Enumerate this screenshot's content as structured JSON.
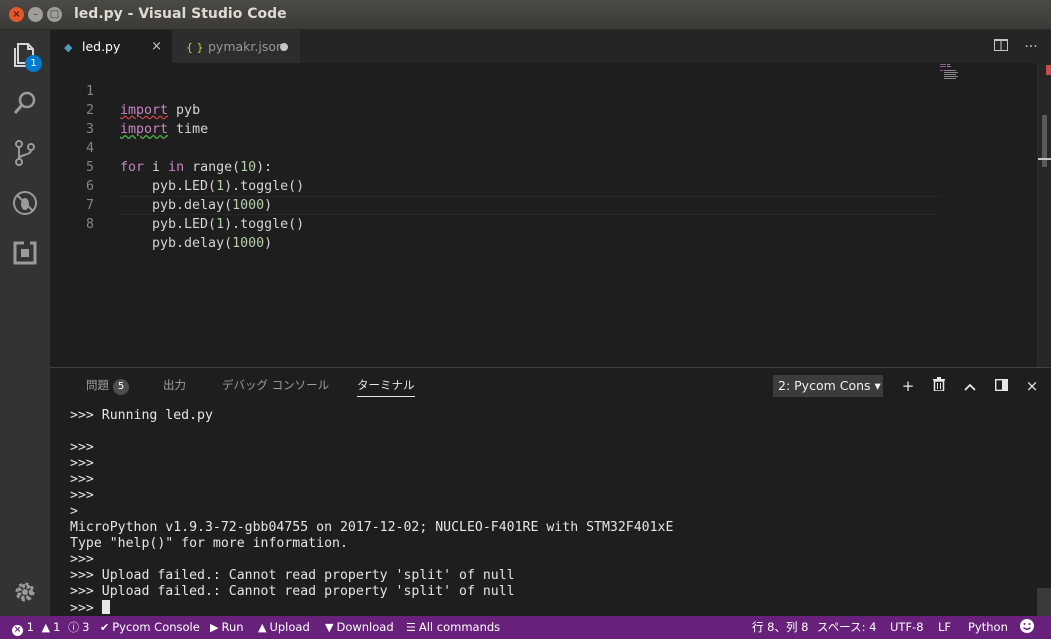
{
  "window": {
    "title": "led.py - Visual Studio Code",
    "close_glyph": "×",
    "min_glyph": "–",
    "max_glyph": "□"
  },
  "activity": {
    "explorer_badge": "1"
  },
  "tabs": [
    {
      "label": "led.py",
      "icon": "python-icon",
      "close": "×"
    },
    {
      "label": "pymakr.json",
      "icon": "{ }"
    }
  ],
  "tabbar_actions": {
    "more": "···"
  },
  "editor": {
    "line_numbers": [
      "1",
      "2",
      "3",
      "4",
      "5",
      "6",
      "7",
      "8"
    ]
  },
  "panel": {
    "tabs": {
      "problems": "問題",
      "problems_count": "5",
      "output": "出力",
      "debug_console": "デバッグ コンソール",
      "terminal": "ターミナル"
    },
    "terminal_select": "2: Pycom Cons ▾",
    "actions": {
      "add": "+",
      "close": "×"
    },
    "terminal_lines": [
      ">>> Running led.py",
      "",
      ">>>",
      ">>>",
      ">>>",
      ">>>",
      ">",
      "MicroPython v1.9.3-72-gbb04755 on 2017-12-02; NUCLEO-F401RE with STM32F401xE",
      "Type \"help()\" for more information.",
      ">>>",
      ">>> Upload failed.: Cannot read property 'split' of null",
      ">>> Upload failed.: Cannot read property 'split' of null",
      ">>> "
    ]
  },
  "statusbar": {
    "errors": "1",
    "warnings": "1",
    "infos": "3",
    "pycom_console": "Pycom Console",
    "run": "Run",
    "upload": "Upload",
    "download": "Download",
    "all_commands": "All commands",
    "position": "行 8、列 8",
    "spaces": "スペース: 4",
    "encoding": "UTF-8",
    "eol": "LF",
    "language": "Python"
  },
  "colors": {
    "statusbar": "#68217a",
    "accent": "#007acc",
    "keyword": "#c586c0",
    "number": "#b5cea8"
  }
}
